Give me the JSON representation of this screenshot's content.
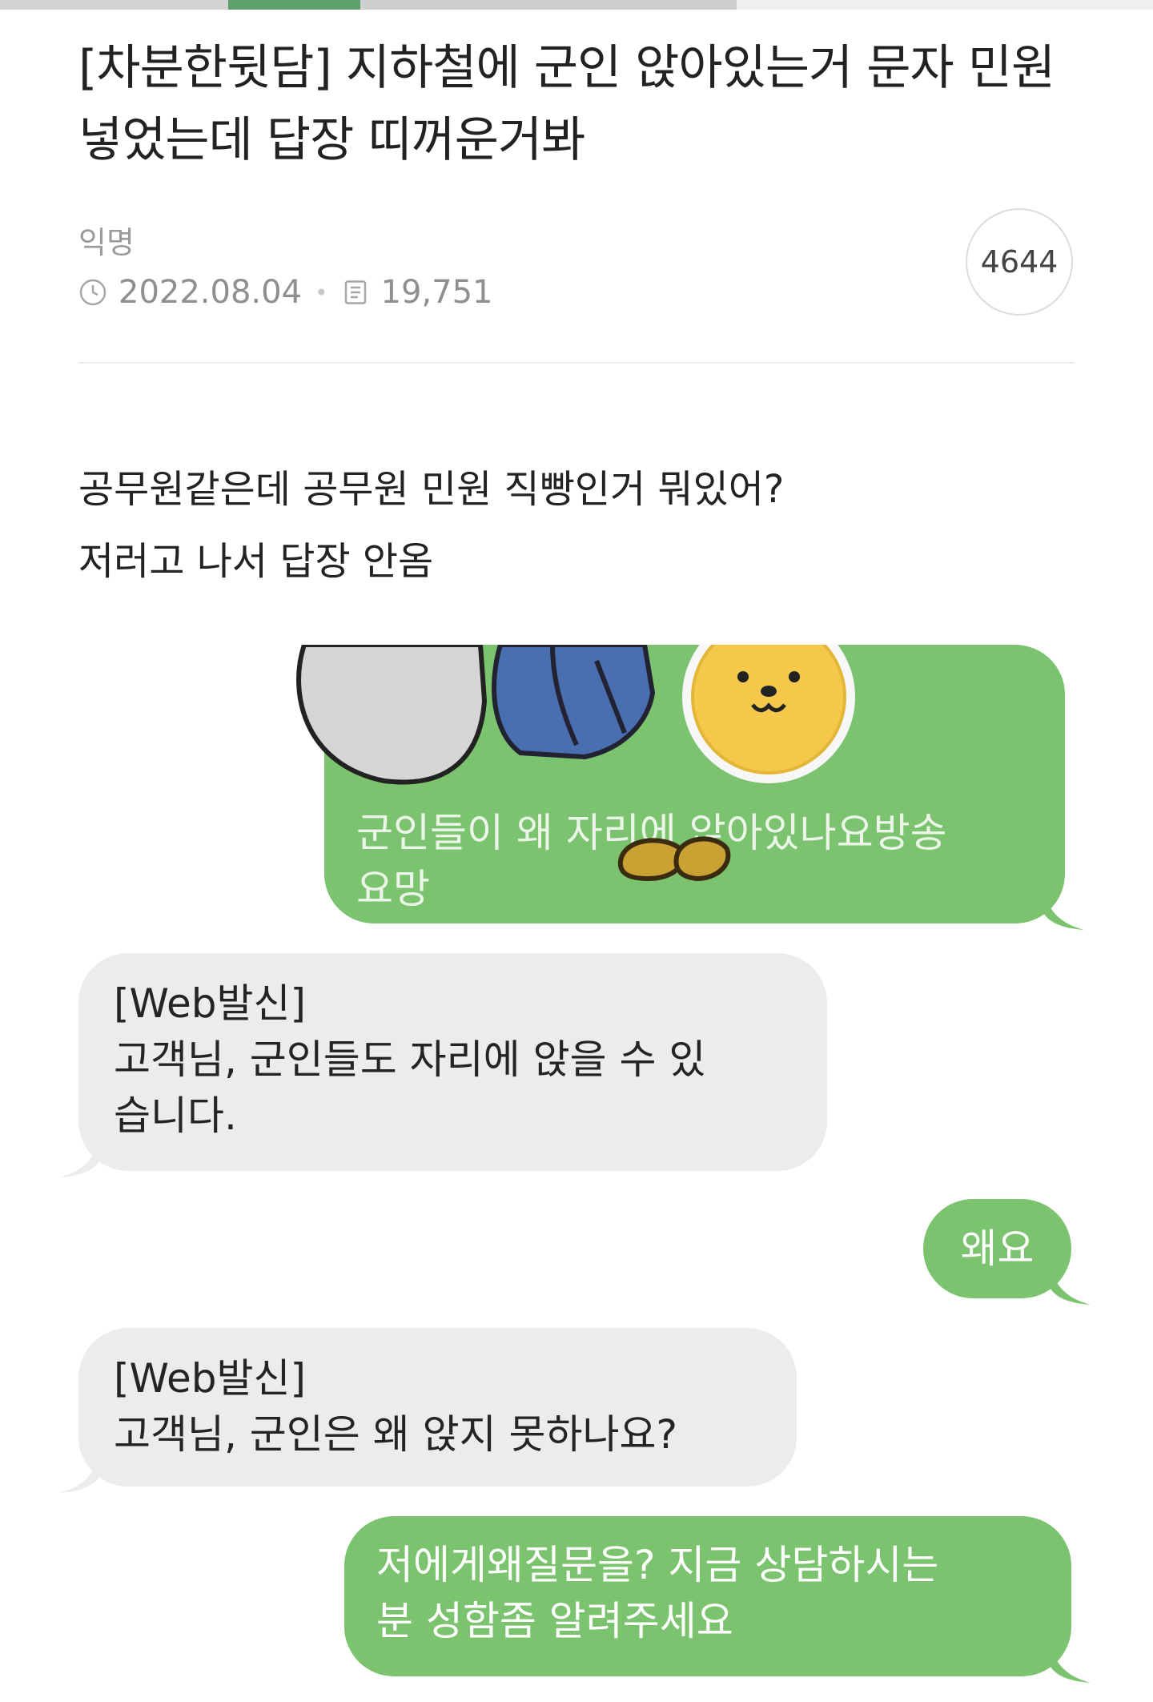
{
  "post": {
    "title": "[차분한뒷담] 지하철에 군인 앉아있는거 문자 민원 넣었는데 답장 띠꺼운거봐",
    "author": "익명",
    "date": "2022.08.04",
    "views": "19,751",
    "comment_count": "4644",
    "body_lines": [
      "공무원같은데 공무원 민원 직빵인거 뭐있어?",
      "저러고 나서 답장 안옴"
    ]
  },
  "chat": {
    "messages": [
      {
        "side": "sent",
        "lines": [
          "군인들이 왜 자리에 앉아있나요방송",
          "요망"
        ]
      },
      {
        "side": "received",
        "lines": [
          "[Web발신]",
          "고객님, 군인들도 자리에 앉을 수 있",
          "습니다."
        ]
      },
      {
        "side": "sent",
        "lines": [
          "왜요"
        ]
      },
      {
        "side": "received",
        "lines": [
          "[Web발신]",
          "고객님, 군인은 왜 앉지 못하나요?"
        ]
      },
      {
        "side": "sent",
        "lines": [
          "저에게왜질문을? 지금 상담하시는",
          "분 성함좀 알려주세요"
        ]
      }
    ]
  },
  "icons": {
    "date": "clock-icon",
    "views": "document-icon",
    "sticker": "character-sticker-icon"
  },
  "colors": {
    "sent_bubble": "#7cc36f",
    "received_bubble": "#ececec",
    "title_text": "#222222",
    "meta_text": "#8f8f8f"
  }
}
